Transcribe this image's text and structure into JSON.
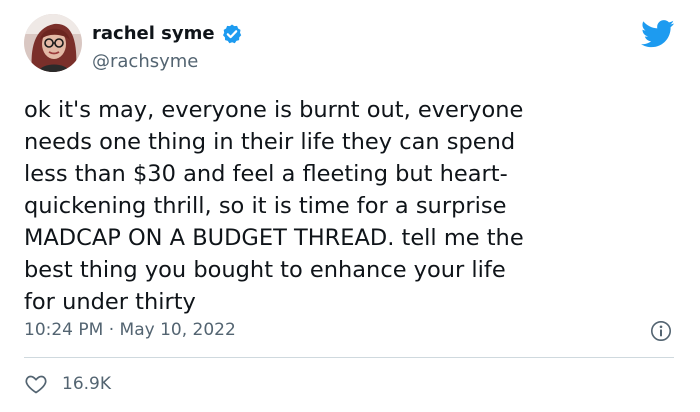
{
  "author": {
    "display_name": "rachel syme",
    "handle": "@rachsyme",
    "verified": true
  },
  "tweet": {
    "text_lines": [
      "ok it's may, everyone is burnt out, everyone",
      "needs one thing in their life they can spend",
      "less than $30 and feel a fleeting but heart-",
      "quickening thrill, so it is time for a surprise",
      "MADCAP ON A BUDGET THREAD. tell me the",
      "best thing you bought to enhance your life",
      "for under thirty"
    ],
    "time": "10:24 PM",
    "separator": "·",
    "date": "May 10, 2022",
    "likes": "16.9K"
  },
  "icons": {
    "logo": "twitter-bird-icon",
    "verified": "verified-badge-icon",
    "info": "info-icon",
    "like": "heart-icon"
  },
  "colors": {
    "brand_blue": "#1d9bf0",
    "text_primary": "#0f1419",
    "text_secondary": "#536471",
    "divider": "#cfd9de"
  }
}
